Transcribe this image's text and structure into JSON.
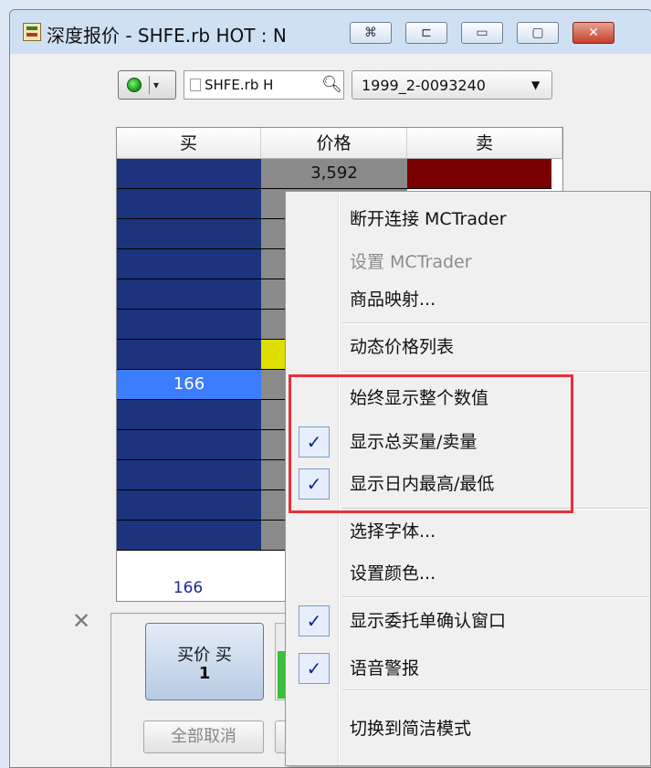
{
  "window": {
    "title": "深度报价 - SHFE.rb HOT : N",
    "controls": {
      "pin_glyph": "⌘",
      "dock_glyph": "⊏",
      "minimize_glyph": "▭",
      "maximize_glyph": "▢",
      "close_glyph": "✕"
    }
  },
  "toolbar": {
    "connection_status": "connected",
    "symbol": "SHFE.rb H",
    "account": "1999_2-0093240"
  },
  "ladder": {
    "headers": {
      "bid": "买",
      "price": "价格",
      "ask": "卖"
    },
    "visible_price": "3,592",
    "highlight_bid_qty": "166",
    "total_bid": "166",
    "colors": {
      "bid": "#1b347d",
      "bid_highlight": "#3b7dfd",
      "price": "#8a8a8a",
      "price_current": "#dede00",
      "ask": "#7a0000"
    }
  },
  "order_panel": {
    "close_tab_glyph": "✕",
    "buy_line1": "买价 买",
    "buy_line2": "1",
    "cancel_all": "全部取消",
    "volume_fill_fraction": 0.62
  },
  "context_menu": {
    "items": [
      {
        "label": "断开连接 MCTrader",
        "checked": false,
        "enabled": true
      },
      {
        "label": "设置 MCTrader",
        "checked": false,
        "enabled": false
      },
      {
        "label": "商品映射...",
        "checked": false,
        "enabled": true
      },
      {
        "label": "动态价格列表",
        "checked": false,
        "enabled": true
      },
      {
        "label": "始终显示整个数值",
        "checked": false,
        "enabled": true
      },
      {
        "label": "显示总买量/卖量",
        "checked": true,
        "enabled": true
      },
      {
        "label": "显示日内最高/最低",
        "checked": true,
        "enabled": true
      },
      {
        "label": "选择字体...",
        "checked": false,
        "enabled": true
      },
      {
        "label": "设置颜色...",
        "checked": false,
        "enabled": true
      },
      {
        "label": "显示委托单确认窗口",
        "checked": true,
        "enabled": true
      },
      {
        "label": "语音警报",
        "checked": true,
        "enabled": true
      },
      {
        "label": "切换到简洁模式",
        "checked": false,
        "enabled": true
      }
    ],
    "check_glyph": "✓",
    "highlight_color": "#e8303a"
  }
}
